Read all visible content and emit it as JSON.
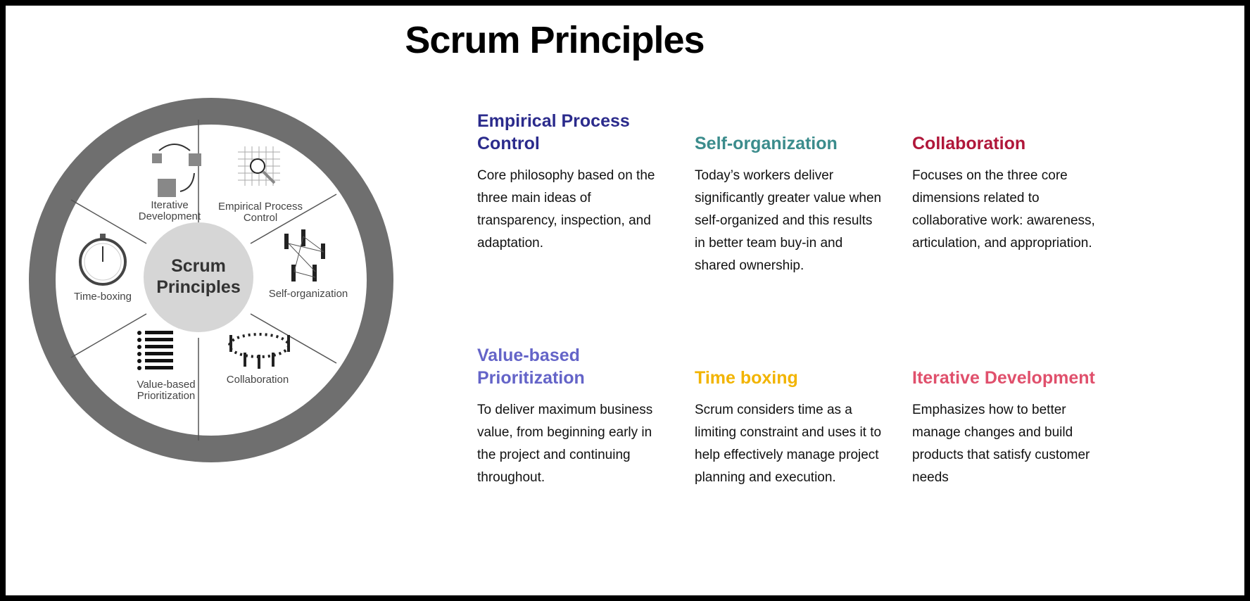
{
  "title": "Scrum Principles",
  "wheel": {
    "center": [
      "Scrum",
      "Principles"
    ],
    "segments": [
      {
        "label": [
          "Iterative",
          "Development"
        ],
        "icon": "iteration-arrows-icon"
      },
      {
        "label": [
          "Empirical Process",
          "Control"
        ],
        "icon": "magnifier-grid-icon"
      },
      {
        "label": [
          "Self-organization"
        ],
        "icon": "connected-people-icon"
      },
      {
        "label": [
          "Collaboration"
        ],
        "icon": "people-circle-icon"
      },
      {
        "label": [
          "Value-based",
          "Prioritization"
        ],
        "icon": "priority-list-icon"
      },
      {
        "label": [
          "Time-boxing"
        ],
        "icon": "stopwatch-icon"
      }
    ],
    "colors": {
      "ring": "#6f6f6f",
      "center": "#d6d6d6"
    }
  },
  "principles": [
    {
      "title": "Empirical Process Control",
      "color": "#2b2b8c",
      "text": "Core philosophy based on the three main ideas of transparency, inspection, and adaptation."
    },
    {
      "title": "Self-organization",
      "color": "#3b8c8c",
      "text": "Today’s workers deliver significantly greater value when self-organized and this results in better team buy-in and shared ownership."
    },
    {
      "title": "Collaboration",
      "color": "#b0173a",
      "text": "Focuses on the three core dimensions related to collaborative work: awareness, articulation, and appropriation."
    },
    {
      "title": "Value-based Prioritization",
      "color": "#6464c8",
      "text": "To deliver maximum business value, from beginning early in the project and continuing throughout."
    },
    {
      "title": "Time boxing",
      "color": "#f2b400",
      "text": "Scrum considers time as a limiting constraint and uses it to help effectively manage project planning and execution."
    },
    {
      "title": "Iterative Development",
      "color": "#e0506c",
      "text": "Emphasizes how to better manage changes and build products that satisfy customer needs"
    }
  ]
}
